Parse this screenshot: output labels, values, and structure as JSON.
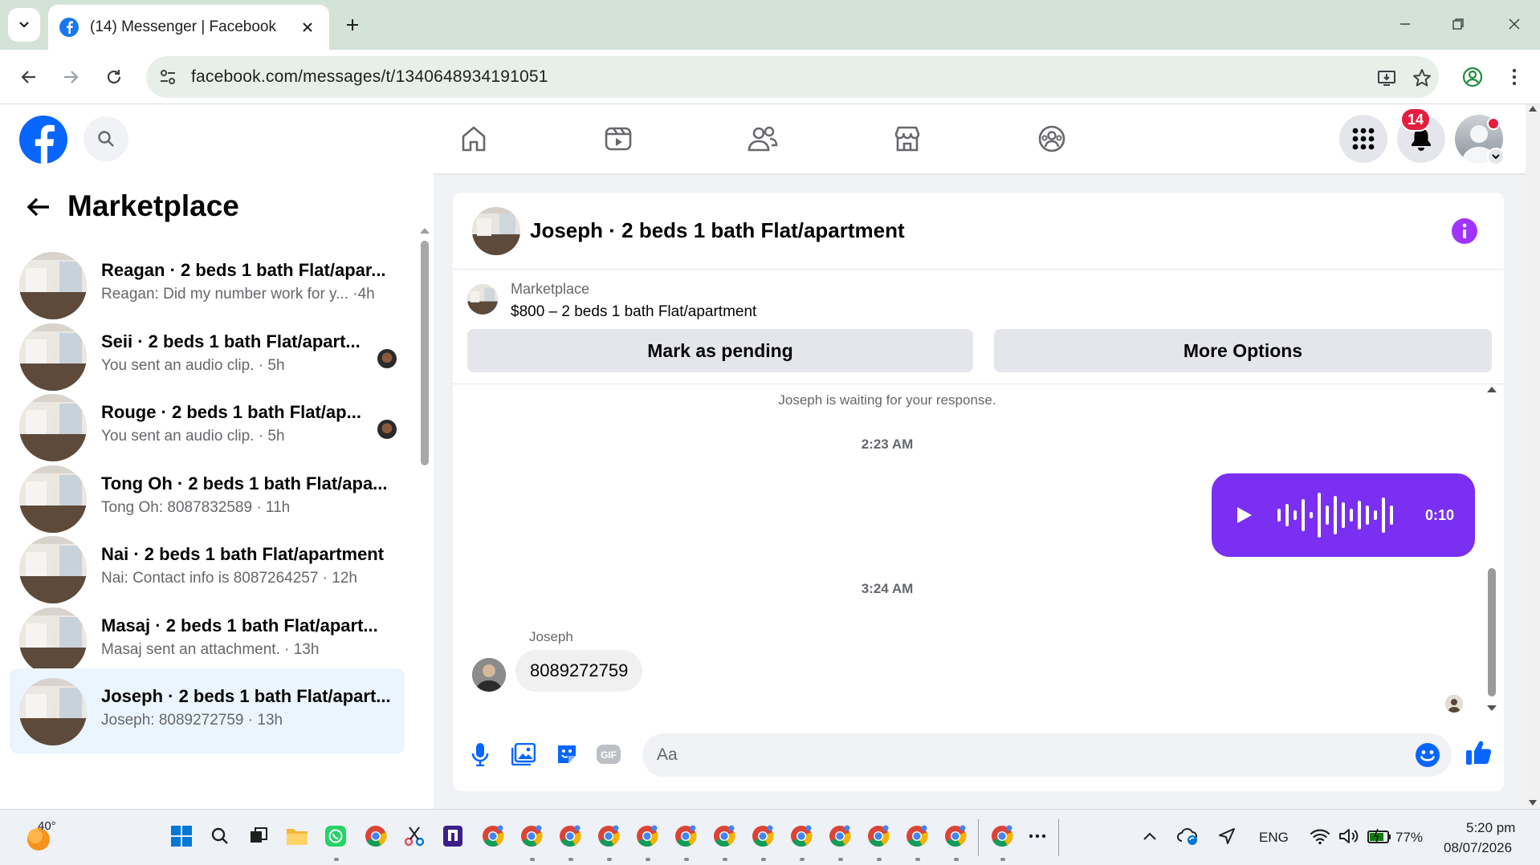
{
  "browser": {
    "tab_title": "(14) Messenger | Facebook",
    "url": "facebook.com/messages/t/1340648934191051"
  },
  "header": {
    "notification_count": "14"
  },
  "sidebar": {
    "title": "Marketplace",
    "conversations": [
      {
        "name": "Reagan · 2 beds 1 bath Flat/apar...",
        "preview": "Reagan: Did my number work for y... ·4h",
        "active": false,
        "seen": false
      },
      {
        "name": "Seii · 2 beds 1 bath Flat/apart...",
        "preview": "You sent an audio clip. · 5h",
        "active": false,
        "seen": true
      },
      {
        "name": "Rouge · 2 beds 1 bath Flat/ap...",
        "preview": "You sent an audio clip. · 5h",
        "active": false,
        "seen": true
      },
      {
        "name": "Tong Oh · 2 beds 1 bath Flat/apa...",
        "preview": "Tong Oh: 8087832589 · 11h",
        "active": false,
        "seen": false
      },
      {
        "name": "Nai · 2 beds 1 bath Flat/apartment",
        "preview": "Nai: Contact info is 8087264257 · 12h",
        "active": false,
        "seen": false
      },
      {
        "name": "Masaj · 2 beds 1 bath Flat/apart...",
        "preview": "Masaj sent an attachment. · 13h",
        "active": false,
        "seen": false
      },
      {
        "name": "Joseph · 2 beds 1 bath Flat/apart...",
        "preview": "Joseph: 8089272759 · 13h",
        "active": true,
        "seen": false
      }
    ]
  },
  "chat": {
    "title": "Joseph · 2 beds 1 bath Flat/apartment",
    "listing_source": "Marketplace",
    "listing_title": "$800 – 2 beds 1 bath Flat/apartment",
    "mark_pending_label": "Mark as pending",
    "more_options_label": "More Options",
    "waiting_note": "Joseph is waiting for your response.",
    "time_1": "2:23 AM",
    "audio_duration": "0:10",
    "time_2": "3:24 AM",
    "sender_name": "Joseph",
    "message_text": "8089272759",
    "composer_placeholder": "Aa"
  },
  "taskbar": {
    "weather_temp": "40°",
    "language": "ENG",
    "battery": "77%",
    "time": "5:20 pm",
    "date": "08/07/2026"
  },
  "colors": {
    "fb_blue": "#0866ff",
    "audio_bubble": "#7a2ff2",
    "badge_red": "#e41e3f",
    "info_purple": "#a033ff"
  }
}
